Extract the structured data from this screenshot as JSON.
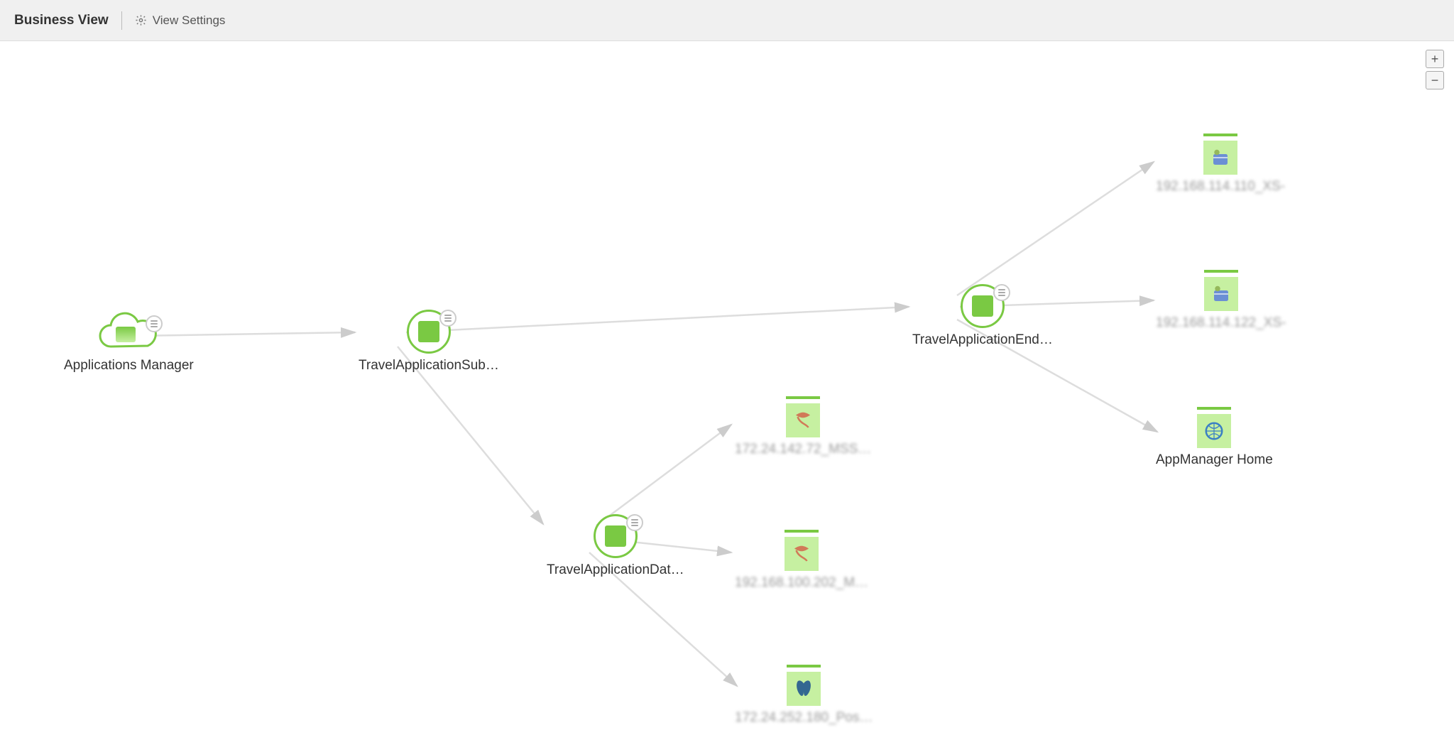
{
  "toolbar": {
    "title": "Business View",
    "settings_label": "View Settings"
  },
  "zoom": {
    "in_label": "+",
    "out_label": "−"
  },
  "nodes": {
    "root": {
      "label": "Applications Manager"
    },
    "sub": {
      "label": "TravelApplicationSub…"
    },
    "end": {
      "label": "TravelApplicationEnd…"
    },
    "dat": {
      "label": "TravelApplicationDat…"
    },
    "xs1": {
      "label": "192.168.114.110_XS-"
    },
    "xs2": {
      "label": "192.168.114.122_XS-"
    },
    "home": {
      "label": "AppManager Home"
    },
    "mss": {
      "label": "172.24.142.72_MSS…"
    },
    "m2": {
      "label": "192.168.100.202_M…"
    },
    "pos": {
      "label": "172.24.252.180_Pos…"
    }
  },
  "chart_data": {
    "type": "graph",
    "nodes": [
      {
        "id": "root",
        "label": "Applications Manager",
        "kind": "cloud-root"
      },
      {
        "id": "sub",
        "label": "TravelApplicationSub…",
        "kind": "group"
      },
      {
        "id": "end",
        "label": "TravelApplicationEnd…",
        "kind": "group"
      },
      {
        "id": "dat",
        "label": "TravelApplicationDat…",
        "kind": "group"
      },
      {
        "id": "xs1",
        "label": "192.168.114.110_XS-",
        "kind": "server-leaf",
        "blurred": true
      },
      {
        "id": "xs2",
        "label": "192.168.114.122_XS-",
        "kind": "server-leaf",
        "blurred": true
      },
      {
        "id": "home",
        "label": "AppManager Home",
        "kind": "web-leaf"
      },
      {
        "id": "mss",
        "label": "172.24.142.72_MSS…",
        "kind": "db-leaf",
        "blurred": true
      },
      {
        "id": "m2",
        "label": "192.168.100.202_M…",
        "kind": "db-leaf",
        "blurred": true
      },
      {
        "id": "pos",
        "label": "172.24.252.180_Pos…",
        "kind": "postgres-leaf",
        "blurred": true
      }
    ],
    "edges": [
      [
        "root",
        "sub"
      ],
      [
        "sub",
        "end"
      ],
      [
        "sub",
        "dat"
      ],
      [
        "end",
        "xs1"
      ],
      [
        "end",
        "xs2"
      ],
      [
        "end",
        "home"
      ],
      [
        "dat",
        "mss"
      ],
      [
        "dat",
        "m2"
      ],
      [
        "dat",
        "pos"
      ]
    ]
  }
}
